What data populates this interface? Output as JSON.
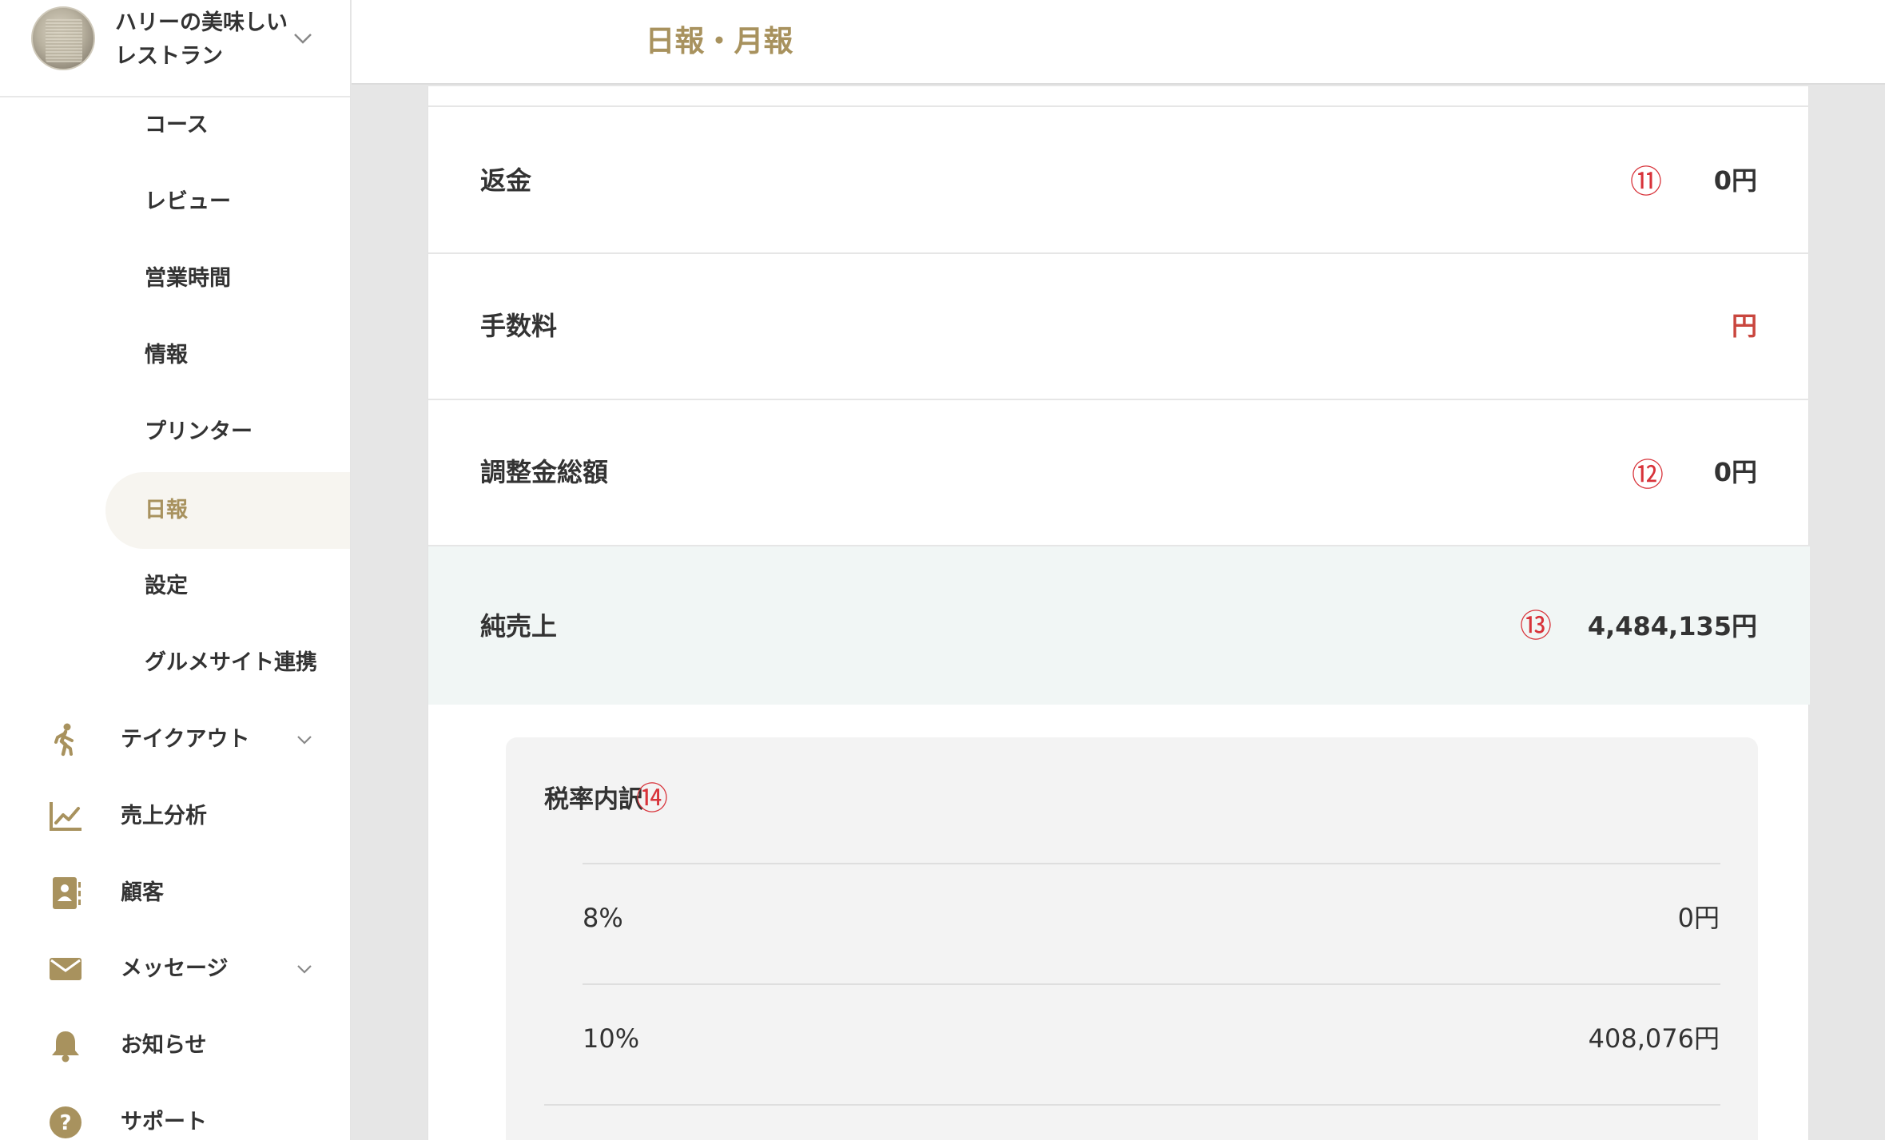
{
  "shop": {
    "name_line1": "ハリーの美味しい",
    "name_line2": "レストラン"
  },
  "sidebar": {
    "sub_items": [
      {
        "label": "コース"
      },
      {
        "label": "レビュー"
      },
      {
        "label": "営業時間"
      },
      {
        "label": "情報"
      },
      {
        "label": "プリンター"
      },
      {
        "label": "日報"
      },
      {
        "label": "設定"
      },
      {
        "label": "グルメサイト連携"
      }
    ],
    "main_items": [
      {
        "label": "テイクアウト",
        "icon": "walking-person-icon"
      },
      {
        "label": "売上分析",
        "icon": "line-chart-icon"
      },
      {
        "label": "顧客",
        "icon": "contact-book-icon"
      },
      {
        "label": "メッセージ",
        "icon": "envelope-icon"
      },
      {
        "label": "お知らせ",
        "icon": "bell-icon"
      },
      {
        "label": "サポート",
        "icon": "help-circle-icon"
      }
    ]
  },
  "header": {
    "title": "日報・月報"
  },
  "report": {
    "refund": {
      "label": "返金",
      "marker": "⑪",
      "value": "0円"
    },
    "fee": {
      "label": "手数料",
      "value": "円"
    },
    "adjustment": {
      "label": "調整金総額",
      "marker": "⑫",
      "value": "0円"
    },
    "net_sales": {
      "label": "純売上",
      "marker": "⑬",
      "value": "4,484,135円"
    },
    "tax_breakdown": {
      "title": "税率内訳",
      "marker": "⑭",
      "rows": [
        {
          "rate": "8%",
          "amount": "0円"
        },
        {
          "rate": "10%",
          "amount": "408,076円"
        }
      ]
    }
  },
  "colors": {
    "accent": "#a8925e",
    "marker_red": "#d8333a",
    "highlight_bg": "#f1f6f5"
  }
}
